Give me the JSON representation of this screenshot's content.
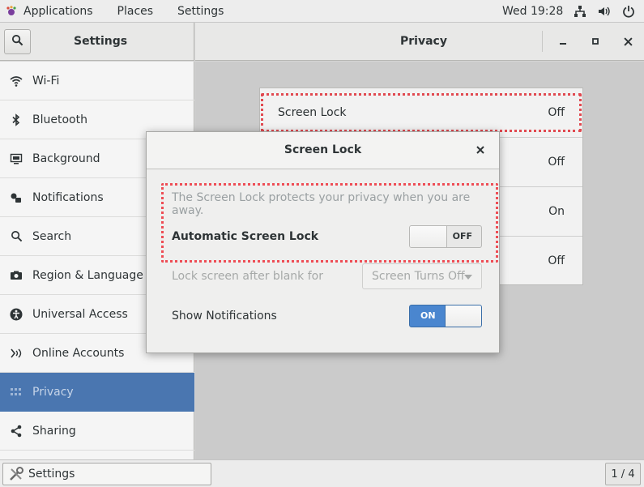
{
  "topbar": {
    "applications": "Applications",
    "places": "Places",
    "settings": "Settings",
    "clock": "Wed 19:28",
    "tray_icons": [
      "network-icon",
      "volume-icon",
      "power-icon"
    ]
  },
  "window": {
    "sidebar_title": "Settings",
    "panel_title": "Privacy",
    "controls": {
      "minimize": "–",
      "maximize": "▫",
      "close": "✕"
    }
  },
  "sidebar": {
    "items": [
      {
        "label": "Wi-Fi",
        "icon": "wifi-icon"
      },
      {
        "label": "Bluetooth",
        "icon": "bluetooth-icon"
      },
      {
        "label": "Background",
        "icon": "background-icon"
      },
      {
        "label": "Notifications",
        "icon": "notifications-icon"
      },
      {
        "label": "Search",
        "icon": "search-icon"
      },
      {
        "label": "Region & Language",
        "icon": "region-icon"
      },
      {
        "label": "Universal Access",
        "icon": "universal-access-icon"
      },
      {
        "label": "Online Accounts",
        "icon": "online-accounts-icon"
      },
      {
        "label": "Privacy",
        "icon": "privacy-icon",
        "active": true
      },
      {
        "label": "Sharing",
        "icon": "sharing-icon"
      }
    ]
  },
  "privacy_panel": {
    "rows": [
      {
        "label": "Screen Lock",
        "value": "Off"
      },
      {
        "label": "",
        "value": "Off"
      },
      {
        "label": "",
        "value": "On"
      },
      {
        "label": "",
        "value": "Off"
      }
    ]
  },
  "dialog": {
    "title": "Screen Lock",
    "close": "×",
    "description": "The Screen Lock protects your privacy when you are away.",
    "auto_lock_label": "Automatic Screen Lock",
    "auto_lock_state": "OFF",
    "lock_after_label": "Lock screen after blank for",
    "lock_after_value": "Screen Turns Off",
    "show_notifications_label": "Show Notifications",
    "show_notifications_state": "ON"
  },
  "taskbar": {
    "task_label": "Settings",
    "pager": "1 / 4"
  },
  "colors": {
    "accent": "#4a76b0",
    "switch_on": "#4a86cf",
    "highlight": "#ee4d55"
  }
}
